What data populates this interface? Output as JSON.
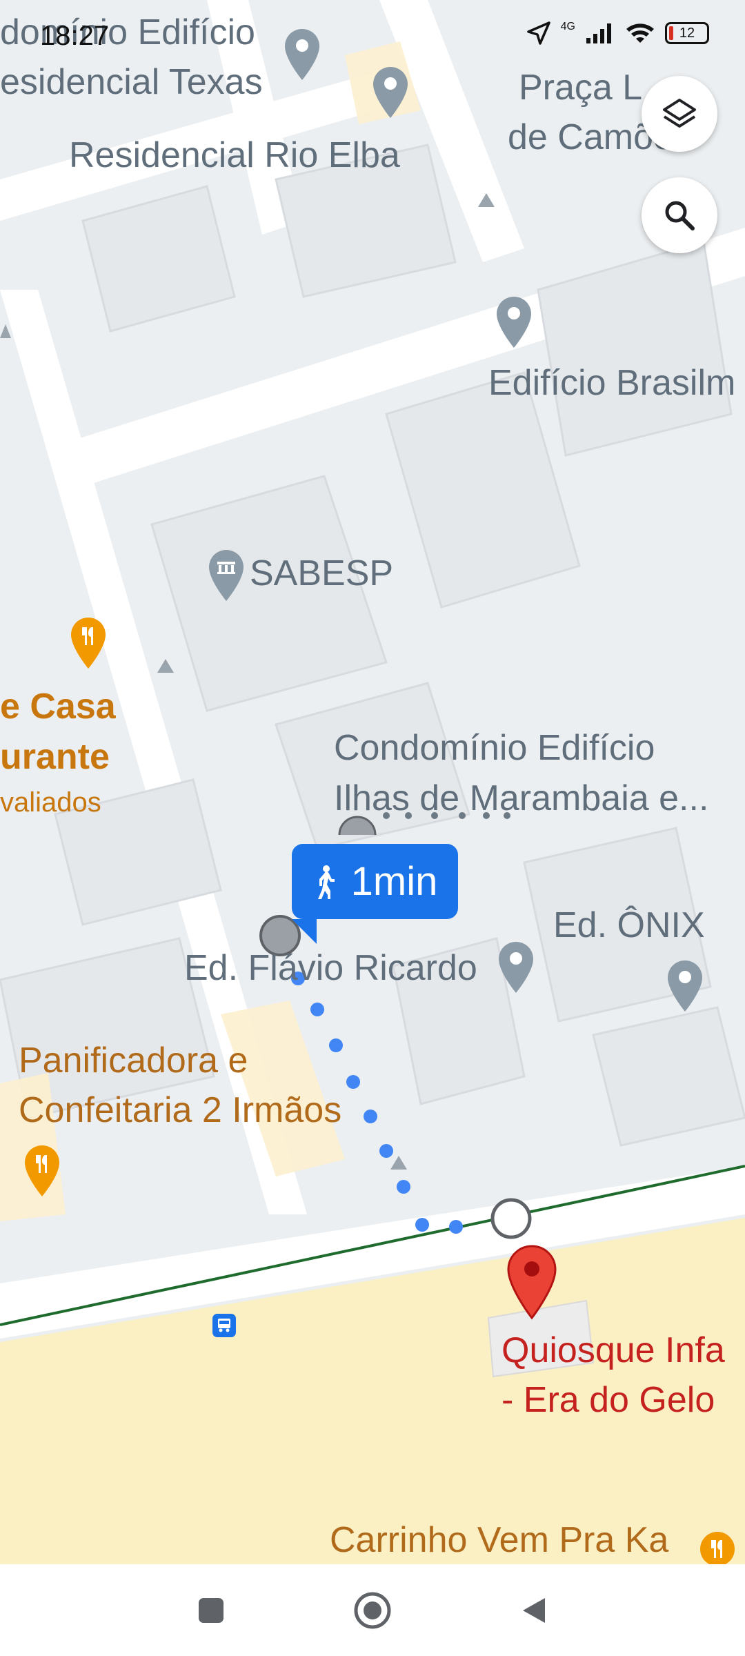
{
  "status_bar": {
    "time": "18:27",
    "network": "4G",
    "battery": "12"
  },
  "map": {
    "labels": {
      "cond_edificio_top": "domínio Edifício",
      "residencial_texas": "esidencial Texas",
      "residencial_rio_elba": "Residencial Rio Elba",
      "praca_line1": "Praça L",
      "praca_line2": "de Camões",
      "edificio_brasil": "Edifício Brasilm",
      "sabesp": "SABESP",
      "casa_line1": "e Casa",
      "casa_line2": "urante",
      "casa_line3": "valiados",
      "ilhas_line1": "Condomínio Edifício",
      "ilhas_line2": "Ilhas de Marambaia e...",
      "onix": "Ed. ÔNIX",
      "flavio": "Ed. Flávio Ricardo",
      "panif_line1": "Panificadora e",
      "panif_line2": "Confeitaria 2 Irmãos",
      "quiosque_line1": "Quiosque Infa",
      "quiosque_line2": "- Era do Gelo",
      "carrinho": "Carrinho Vem Pra Ka"
    },
    "walk_time": "1min",
    "colors": {
      "route_blue": "#4285f4",
      "destination_red": "#ea4335",
      "poi_gray": "#8a9aa6",
      "poi_orange": "#f29900",
      "beach_sand": "#fbefc4"
    }
  },
  "icons": {
    "layers": "layers-icon",
    "search": "search-icon",
    "walk": "walk-icon",
    "bus_stop": "bus-stop-icon",
    "destination": "destination-pin-icon"
  },
  "nav_bar": {
    "buttons": [
      "recent-apps",
      "home",
      "back"
    ]
  }
}
